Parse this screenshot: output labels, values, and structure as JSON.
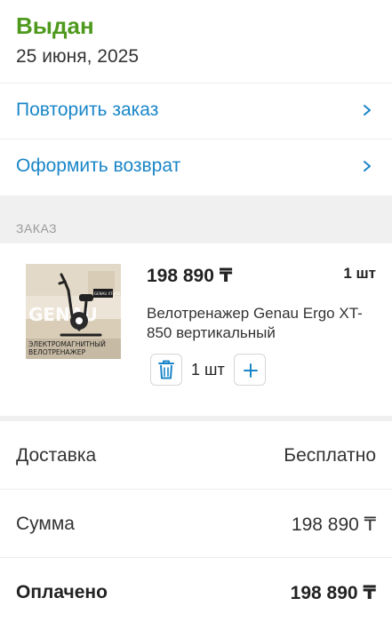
{
  "status": {
    "title": "Выдан",
    "date": "25 июня, 2025",
    "color": "#4f9a1e"
  },
  "actions": [
    {
      "label": "Повторить заказ",
      "icon": "chevron-right-icon"
    },
    {
      "label": "Оформить возврат",
      "icon": "chevron-right-icon"
    }
  ],
  "order_section": {
    "label": "ЗАКАЗ"
  },
  "item": {
    "price": "198 890 ₸",
    "quantity_label": "1 шт",
    "name": "Велотренажер Genau Ergo XT-850 вертикальный",
    "stepper_value": "1 шт",
    "image": {
      "brand": "GENAU",
      "caption_line1": "ЭЛЕКТРОМАГНИТНЫЙ",
      "caption_line2": "ВЕЛОТРЕНАЖЕР",
      "model_tag": "GENAU XT-850"
    }
  },
  "summary": [
    {
      "label": "Доставка",
      "value": "Бесплатно"
    },
    {
      "label": "Сумма",
      "value": "198 890 ₸"
    },
    {
      "label": "Оплачено",
      "value": "198 890 ₸"
    }
  ],
  "colors": {
    "accent": "#1a86c8",
    "status": "#4f9a1e",
    "section_bg": "#f0f0f0"
  }
}
